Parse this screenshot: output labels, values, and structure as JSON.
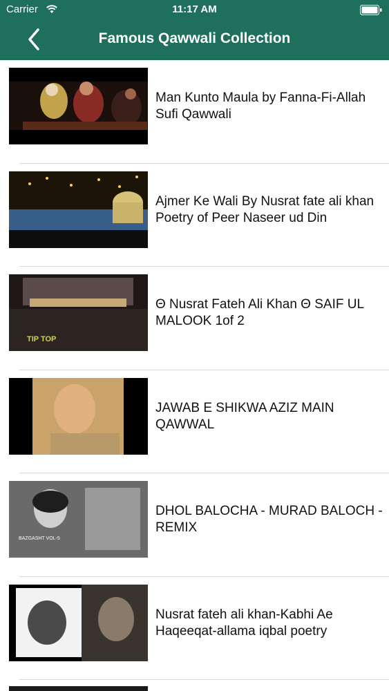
{
  "status_bar": {
    "carrier": "Carrier",
    "time": "11:17 AM"
  },
  "nav": {
    "title": "Famous Qawwali Collection",
    "back_icon": "chevron-left-icon"
  },
  "colors": {
    "header_bg": "#1e6f5c",
    "separator": "#d9d9d9"
  },
  "videos": [
    {
      "title": "Man Kunto Maula by Fanna-Fi-Allah Sufi Qawwali"
    },
    {
      "title": "Ajmer Ke Wali By Nusrat fate ali khan Poetry of Peer Naseer ud Din"
    },
    {
      "title": "Θ Nusrat Fateh Ali Khan Θ SAIF UL MALOOK 1of 2",
      "thumb_caption": "TIP TOP"
    },
    {
      "title": "JAWAB E SHIKWA AZIZ MAIN QAWWAL"
    },
    {
      "title": "DHOL BALOCHA - MURAD BALOCH - REMIX",
      "thumb_caption": "BAZGASHT VOL-5"
    },
    {
      "title": "Nusrat fateh ali khan-Kabhi Ae Haqeeqat-allama iqbal poetry"
    }
  ]
}
